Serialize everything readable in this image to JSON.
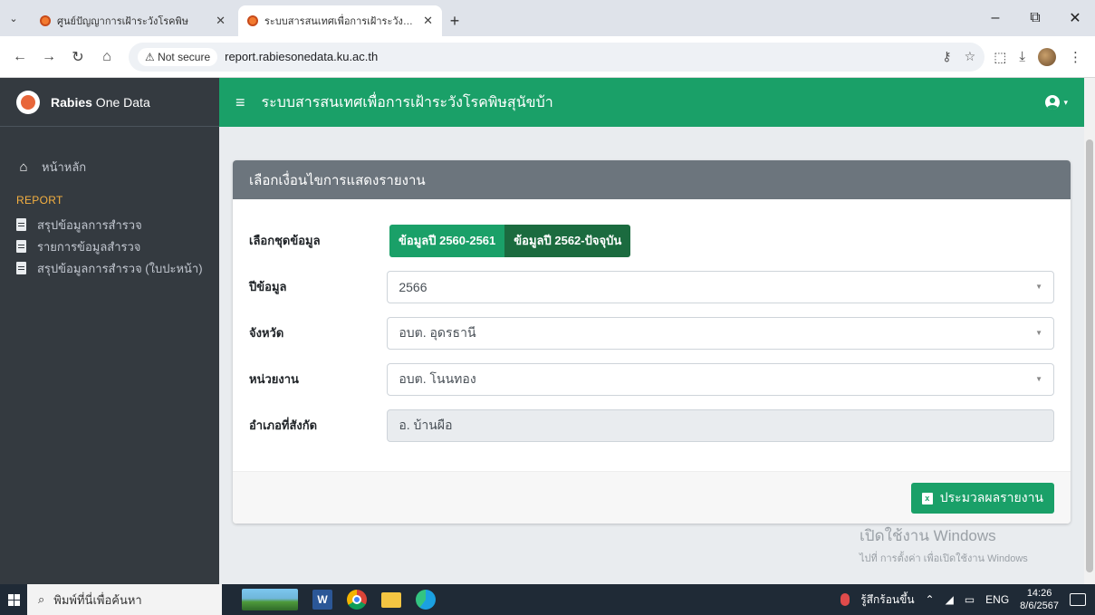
{
  "browser": {
    "tabs": [
      {
        "title": "ศูนย์ปัญญาการเฝ้าระวังโรคพิษ",
        "active": false
      },
      {
        "title": "ระบบสารสนเทศเพื่อการเฝ้าระวังโรคพิ",
        "active": true
      }
    ],
    "security_label": "Not secure",
    "url": "report.rabiesonedata.ku.ac.th"
  },
  "app": {
    "brand_bold": "Rabies",
    "brand_rest": " One Data",
    "title": "ระบบสารสนเทศเพื่อการเฝ้าระวังโรคพิษสุนัขบ้า",
    "sidebar": {
      "home_label": "หน้าหลัก",
      "section_header": "REPORT",
      "items": [
        {
          "label": "สรุปข้อมูลการสำรวจ"
        },
        {
          "label": "รายการข้อมูลสำรวจ"
        },
        {
          "label": "สรุปข้อมูลการสำรวจ (ใบปะหน้า)"
        }
      ]
    },
    "card": {
      "header": "เลือกเงื่อนไขการแสดงรายงาน",
      "dataset_label": "เลือกชุดข้อมูล",
      "dataset_buttons": [
        "ข้อมูลปี 2560-2561",
        "ข้อมูลปี 2562-ปัจจุบัน"
      ],
      "year_label": "ปีข้อมูล",
      "year_value": "2566",
      "province_label": "จังหวัด",
      "province_value": "อบต. อุดรธานี",
      "agency_label": "หน่วยงาน",
      "agency_value": "อบต. โนนทอง",
      "district_label": "อำเภอที่สังกัด",
      "district_value": "อ. บ้านผือ",
      "process_button": "ประมวลผลรายงาน"
    },
    "watermark": {
      "line1": "เปิดใช้งาน Windows",
      "line2": "ไปที่ การตั้งค่า เพื่อเปิดใช้งาน Windows"
    }
  },
  "taskbar": {
    "search_placeholder": "พิมพ์ที่นี่เพื่อค้นหา",
    "weather": "รู้สึกร้อนขึ้น",
    "language": "ENG",
    "time": "14:26",
    "date": "8/6/2567"
  }
}
